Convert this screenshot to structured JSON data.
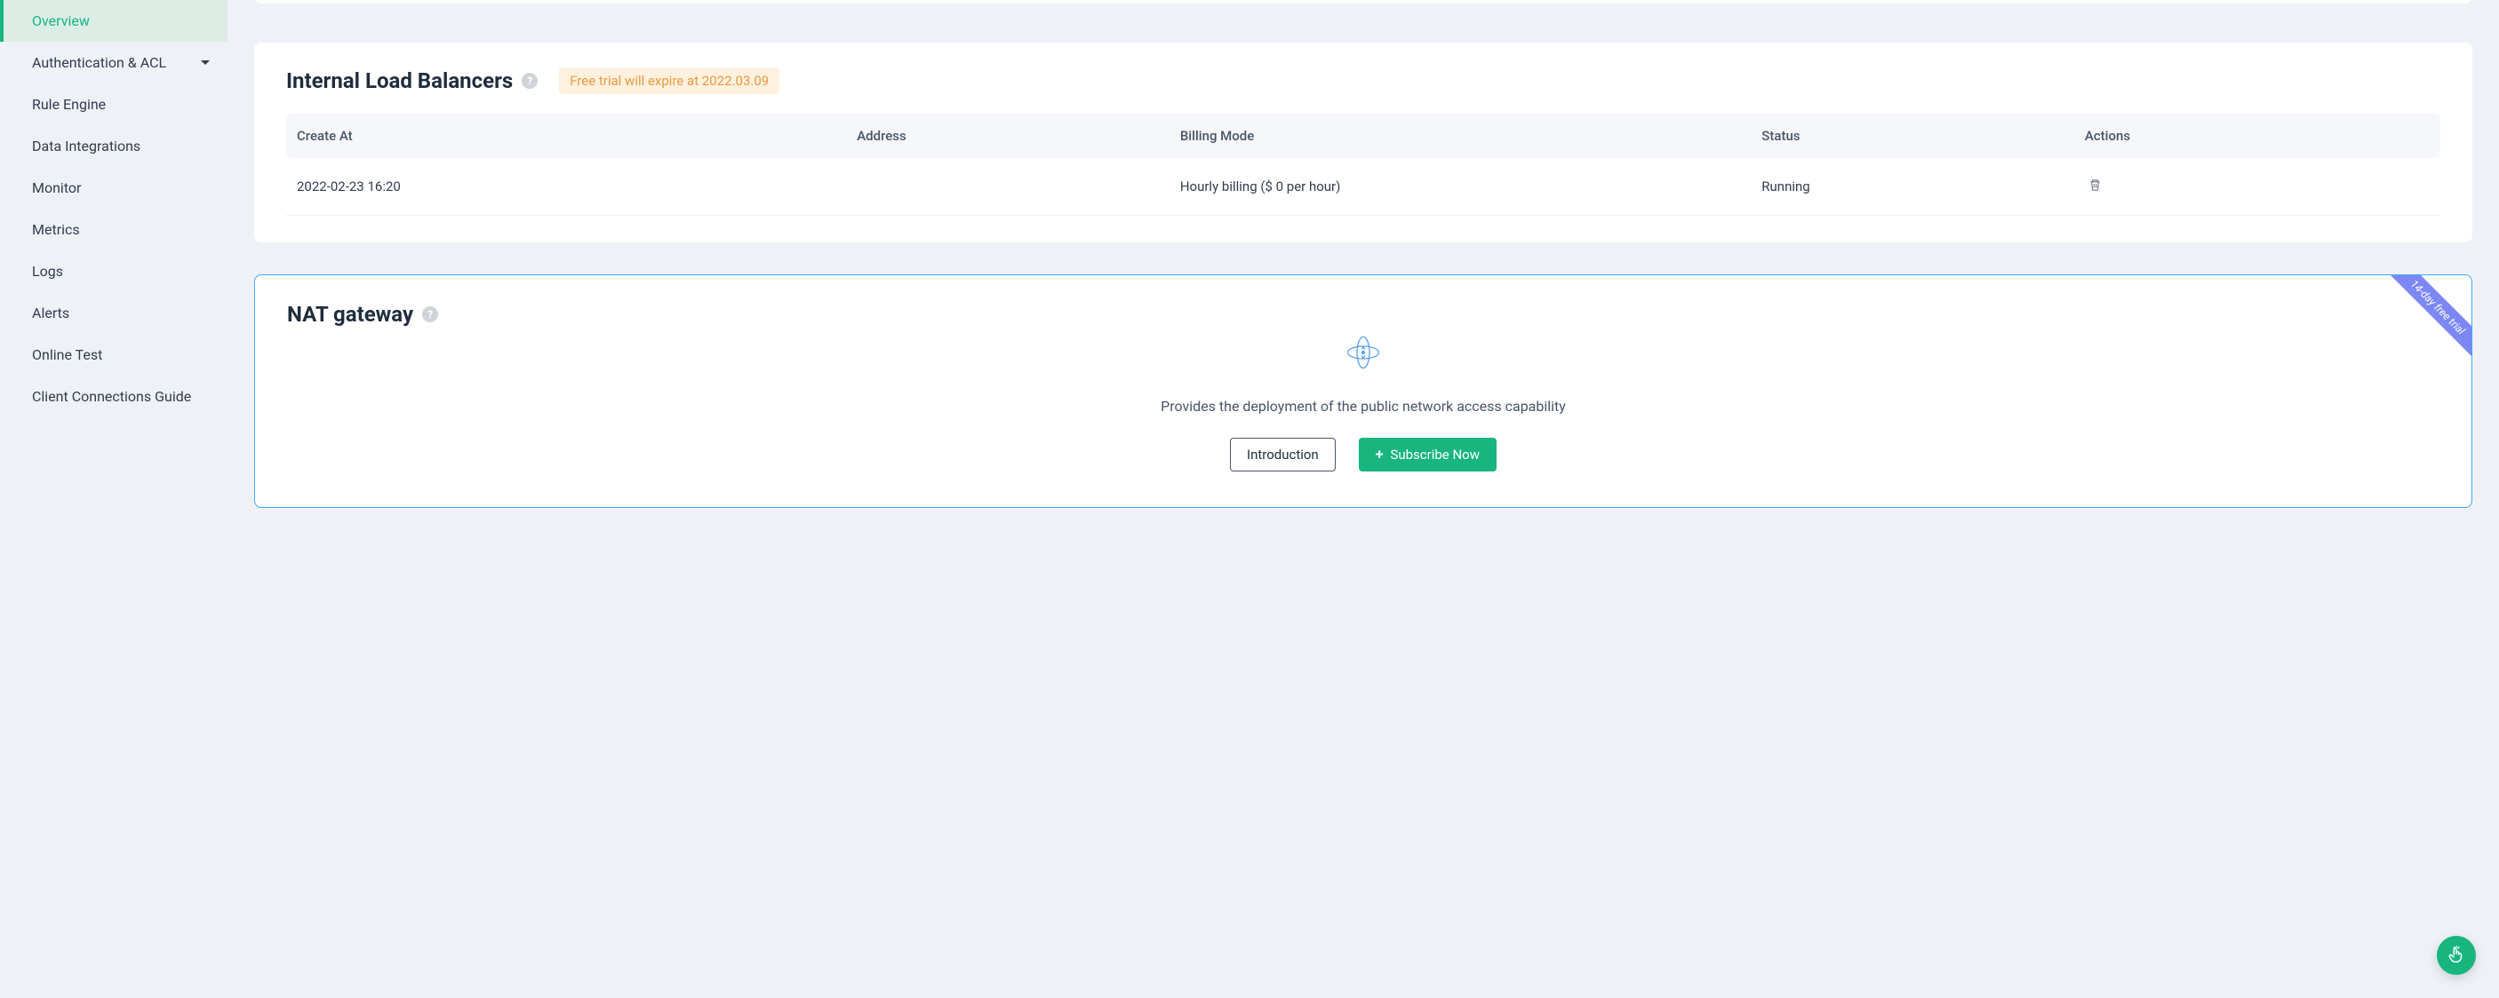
{
  "sidebar": {
    "items": [
      {
        "label": "Overview",
        "active": true,
        "caret": false
      },
      {
        "label": "Authentication & ACL",
        "active": false,
        "caret": true
      },
      {
        "label": "Rule Engine",
        "active": false,
        "caret": false
      },
      {
        "label": "Data Integrations",
        "active": false,
        "caret": false
      },
      {
        "label": "Monitor",
        "active": false,
        "caret": false
      },
      {
        "label": "Metrics",
        "active": false,
        "caret": false
      },
      {
        "label": "Logs",
        "active": false,
        "caret": false
      },
      {
        "label": "Alerts",
        "active": false,
        "caret": false
      },
      {
        "label": "Online Test",
        "active": false,
        "caret": false
      },
      {
        "label": "Client Connections Guide",
        "active": false,
        "caret": false
      }
    ]
  },
  "ilb": {
    "title": "Internal Load Balancers",
    "trial_badge": "Free trial will expire at 2022.03.09",
    "columns": {
      "create_at": "Create At",
      "address": "Address",
      "billing_mode": "Billing Mode",
      "status": "Status",
      "actions": "Actions"
    },
    "rows": [
      {
        "create_at": "2022-02-23 16:20",
        "address": "",
        "billing_mode": "Hourly billing ($ 0 per hour)",
        "status": "Running"
      }
    ]
  },
  "nat": {
    "title": "NAT gateway",
    "description": "Provides the deployment of the public network access capability",
    "intro_btn": "Introduction",
    "subscribe_btn": "Subscribe Now",
    "ribbon": "14-day free trial"
  }
}
